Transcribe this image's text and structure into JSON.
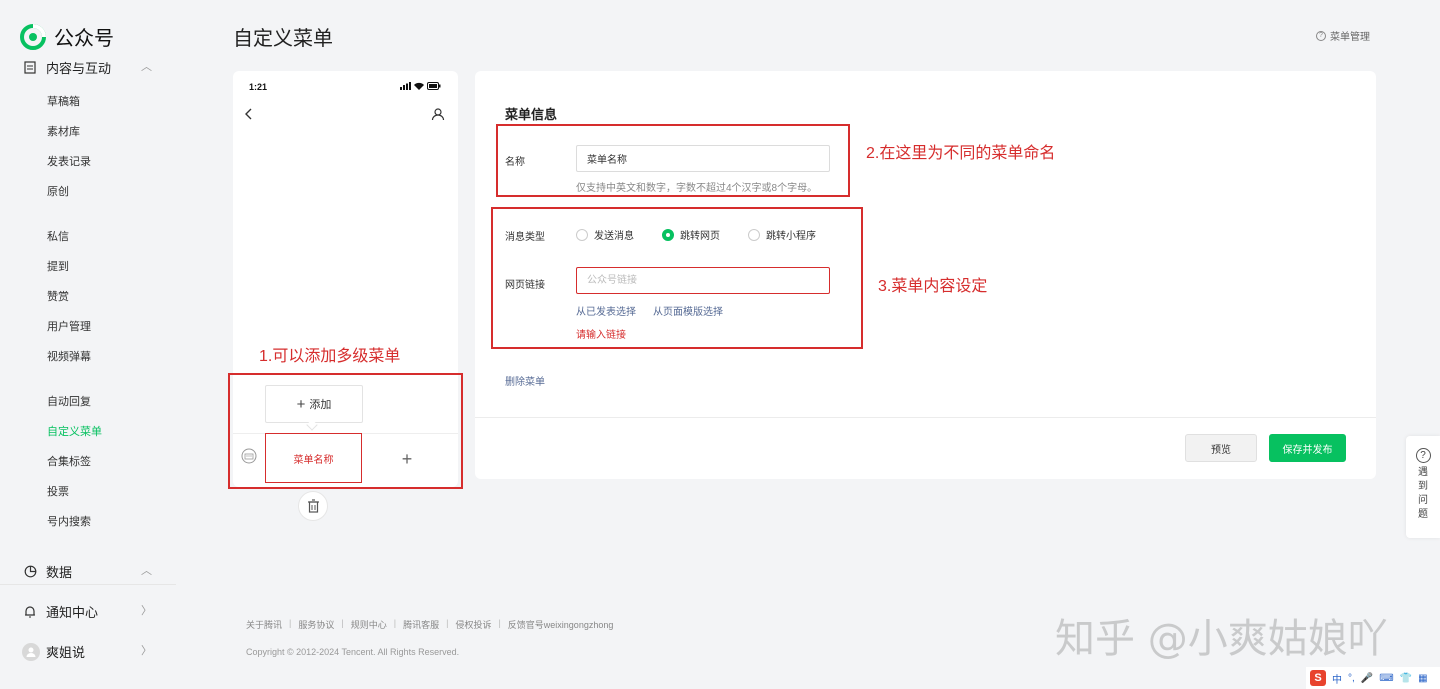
{
  "app": {
    "name": "公众号",
    "brand_color": "#07c160",
    "annotation_color": "#d62d2d"
  },
  "sidebar": {
    "group_content": {
      "label": "内容与互动",
      "icon": "document-icon"
    },
    "content_items": [
      "草稿箱",
      "素材库",
      "发表记录",
      "原创"
    ],
    "interact_items": [
      "私信",
      "提到",
      "赞赏",
      "用户管理",
      "视频弹幕"
    ],
    "feature_items": [
      "自动回复",
      "自定义菜单",
      "合集标签",
      "投票",
      "号内搜索"
    ],
    "active_item": "自定义菜单",
    "group_data": {
      "label": "数据",
      "icon": "pie-chart-icon"
    },
    "notify": {
      "label": "通知中心",
      "icon": "bell-icon"
    },
    "account": {
      "label": "爽姐说",
      "icon": "avatar-icon"
    }
  },
  "header": {
    "title": "自定义菜单",
    "help_link": "菜单管理"
  },
  "phone": {
    "time": "1:21",
    "add_label": "添加",
    "menu_tab_label": "菜单名称"
  },
  "annotations": {
    "a1": "1.可以添加多级菜单",
    "a2": "2.在这里为不同的菜单命名",
    "a3": "3.菜单内容设定"
  },
  "form": {
    "section_title": "菜单信息",
    "name_label": "名称",
    "name_value": "菜单名称",
    "name_hint": "仅支持中英文和数字，字数不超过4个汉字或8个字母。",
    "msg_type_label": "消息类型",
    "msg_types": [
      "发送消息",
      "跳转网页",
      "跳转小程序"
    ],
    "msg_type_selected": "跳转网页",
    "url_label": "网页链接",
    "url_placeholder": "公众号链接",
    "pick_published": "从已发表选择",
    "pick_template": "从页面模版选择",
    "url_error": "请输入链接",
    "delete_menu": "删除菜单",
    "preview_btn": "预览",
    "save_btn": "保存并发布"
  },
  "float_help": {
    "text": "遇到问题"
  },
  "footer": {
    "links": [
      "关于腾讯",
      "服务协议",
      "规则中心",
      "腾讯客服",
      "侵权投诉",
      "反馈官号weixingongzhong"
    ],
    "copyright": "Copyright © 2012-2024 Tencent. All Rights Reserved."
  },
  "watermark": "知乎 @小爽姑娘吖",
  "ime": {
    "logo": "S",
    "mode": "中",
    "punct": "°,"
  }
}
